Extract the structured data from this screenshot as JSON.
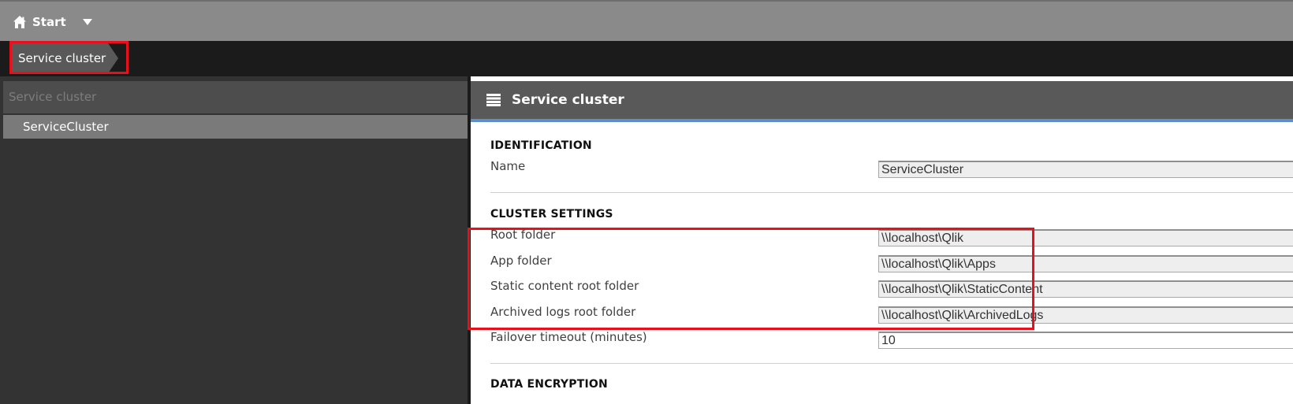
{
  "topbar": {
    "start_label": "Start"
  },
  "breadcrumb": {
    "current": "Service cluster"
  },
  "left_panel": {
    "header": "Service cluster",
    "items": [
      {
        "label": "ServiceCluster"
      }
    ]
  },
  "right_panel": {
    "title": "Service cluster",
    "sections": {
      "identification": {
        "title": "IDENTIFICATION",
        "name_label": "Name",
        "name_value": "ServiceCluster"
      },
      "cluster_settings": {
        "title": "CLUSTER SETTINGS",
        "root_folder_label": "Root folder",
        "root_folder_value": "\\\\localhost\\Qlik",
        "app_folder_label": "App folder",
        "app_folder_value": "\\\\localhost\\Qlik\\Apps",
        "static_content_label": "Static content root folder",
        "static_content_value": "\\\\localhost\\Qlik\\StaticContent",
        "archived_logs_label": "Archived logs root folder",
        "archived_logs_value": "\\\\localhost\\Qlik\\ArchivedLogs",
        "failover_label": "Failover timeout (minutes)",
        "failover_value": "10"
      },
      "data_encryption": {
        "title": "DATA ENCRYPTION"
      }
    }
  },
  "colors": {
    "topbar": "#8a8a8a",
    "breadcrumb_bar": "#1b1b1b",
    "left_panel": "#333333",
    "header_accent": "#5b8fc9",
    "highlight_red": "#e8101a"
  },
  "icons": {
    "home": "home-icon",
    "dropdown": "caret-down-icon",
    "list": "list-icon"
  }
}
